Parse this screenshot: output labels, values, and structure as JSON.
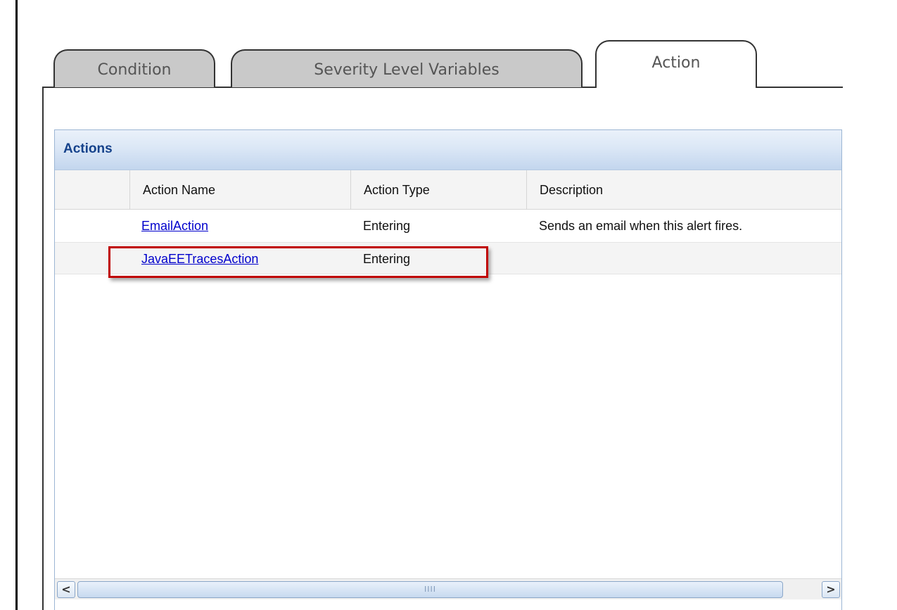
{
  "tabs": [
    {
      "label": "Condition",
      "active": false
    },
    {
      "label": "Severity Level Variables",
      "active": false
    },
    {
      "label": "Action",
      "active": true
    }
  ],
  "panel": {
    "title": "Actions",
    "columns": [
      "Action Name",
      "Action Type",
      "Description"
    ],
    "rows": [
      {
        "name": "EmailAction",
        "type": "Entering",
        "description": "Sends an email when this alert fires."
      },
      {
        "name": "JavaEETracesAction",
        "type": "Entering",
        "description": ""
      }
    ]
  },
  "scrollbar": {
    "left_icon": "scroll-left-arrow",
    "right_icon": "scroll-right-arrow",
    "left_glyph": "<",
    "right_glyph": ">",
    "grip_glyph": "IIII"
  },
  "colors": {
    "link": "#0000cc",
    "highlight_box": "#c00000",
    "panel_title": "#15428b"
  }
}
